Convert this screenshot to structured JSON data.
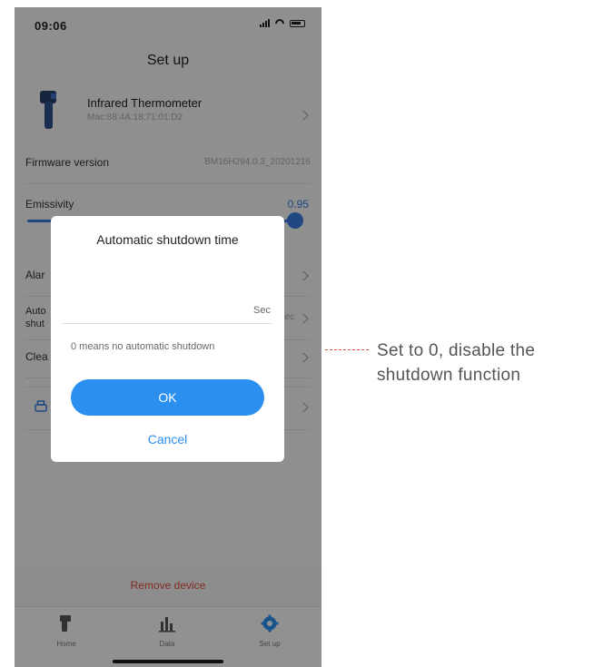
{
  "status_bar": {
    "time": "09:06"
  },
  "header": {
    "title": "Set up"
  },
  "device": {
    "name": "Infrared Thermometer",
    "mac": "Mac:88:4A:18:71:01:D2"
  },
  "settings": {
    "firmware": {
      "label": "Firmware version",
      "value": "BM16H294.0.3_20201216"
    },
    "emissivity": {
      "label": "Emissivity",
      "value": "0.95",
      "level": 0.95
    },
    "alarm": {
      "label": "Alar"
    },
    "auto_shutdown": {
      "label_line1": "Auto",
      "label_line2": "shut",
      "value": "ec"
    },
    "clear": {
      "label": "Clea"
    }
  },
  "dialog": {
    "title": "Automatic shutdown time",
    "input_value": "",
    "unit": "Sec",
    "hint": "0 means no automatic shutdown",
    "ok_label": "OK",
    "cancel_label": "Cancel"
  },
  "footer": {
    "remove_label": "Remove device"
  },
  "tabs": [
    {
      "label": "Home",
      "icon": "thermometer-icon",
      "active": false
    },
    {
      "label": "Data",
      "icon": "bar-chart-icon",
      "active": false
    },
    {
      "label": "Set up",
      "icon": "gear-icon",
      "active": true
    }
  ],
  "annotation": {
    "text": "Set to 0, disable the shutdown function"
  },
  "colors": {
    "accent": "#2b8ff0",
    "danger": "#e24b3b",
    "slider": "#3a7be0"
  }
}
